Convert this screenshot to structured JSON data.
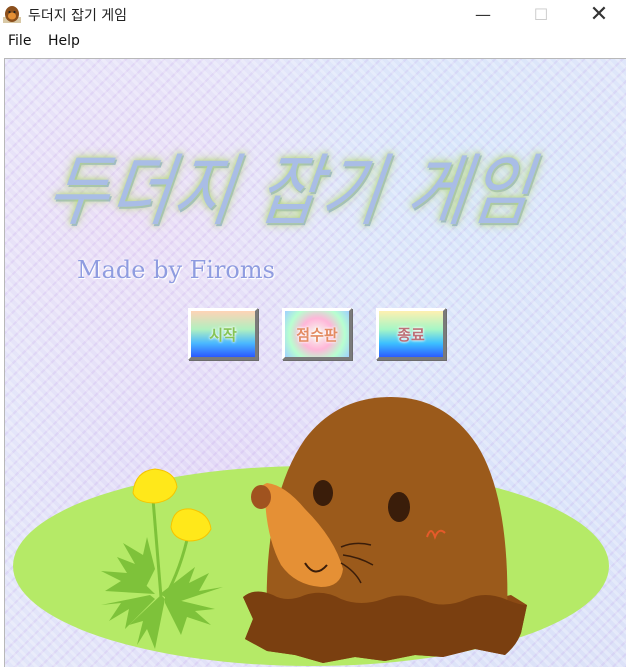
{
  "window": {
    "title": "두더지 잡기 게임",
    "controls": {
      "minimize": "—",
      "maximize": "☐",
      "close": "✕"
    }
  },
  "menubar": {
    "items": [
      "File",
      "Help"
    ]
  },
  "game": {
    "title": "두더지 잡기 게임",
    "subtitle": "Made by Firoms",
    "buttons": {
      "start": "시작",
      "score": "점수판",
      "quit": "종료"
    }
  },
  "icons": {
    "app": "mole-icon"
  },
  "colors": {
    "grass": "#b5ea67",
    "mole_body": "#9b5a1b",
    "mole_face": "#e59035",
    "dandelion": "#ffe81a",
    "title_text": "#a9bde6",
    "subtitle_text": "#8f9ce0"
  }
}
